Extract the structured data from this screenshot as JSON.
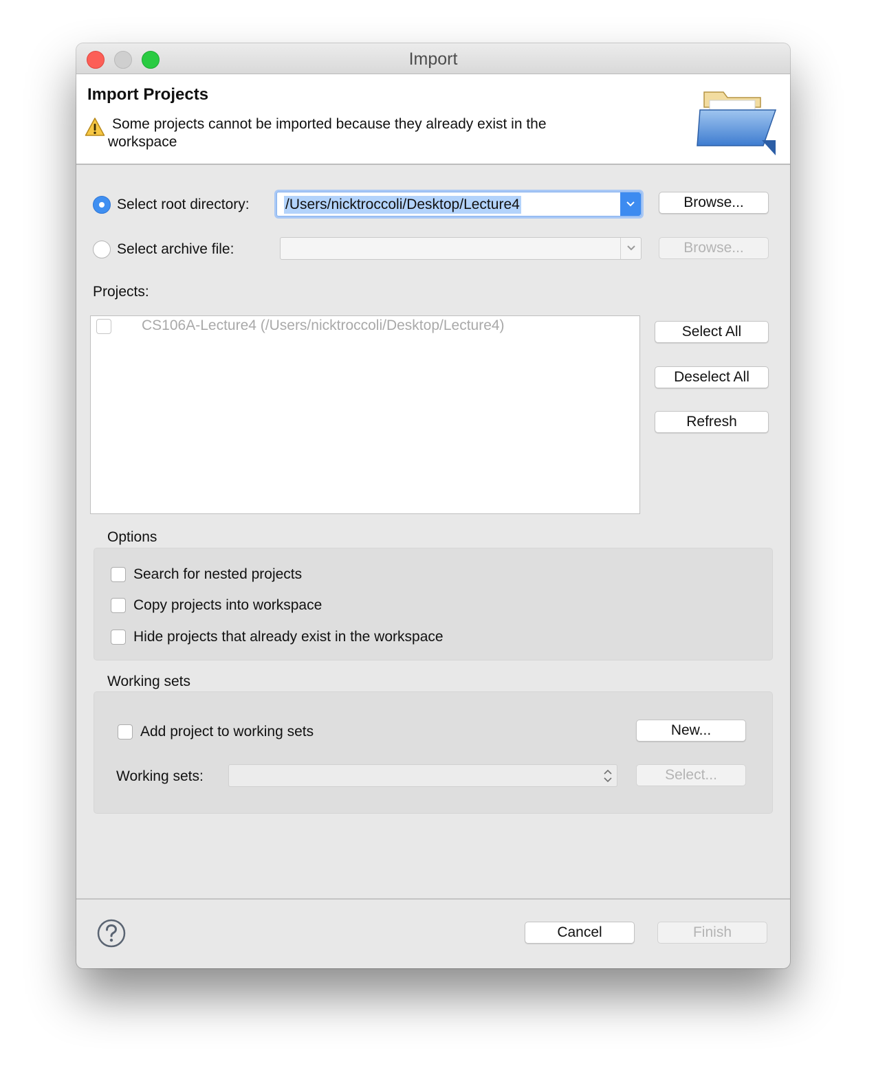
{
  "window": {
    "title": "Import"
  },
  "banner": {
    "title": "Import Projects",
    "message_line1": "Some projects cannot be imported because they already exist in the",
    "message_line2": "workspace"
  },
  "source": {
    "root_label": "Select root directory:",
    "root_value": "/Users/nicktroccoli/Desktop/Lecture4",
    "root_selected": true,
    "archive_label": "Select archive file:",
    "archive_value": "",
    "archive_selected": false,
    "browse_label": "Browse..."
  },
  "projects": {
    "label": "Projects:",
    "items": [
      {
        "label": "CS106A-Lecture4 (/Users/nicktroccoli/Desktop/Lecture4)",
        "checked": false,
        "enabled": false
      }
    ],
    "select_all": "Select All",
    "deselect_all": "Deselect All",
    "refresh": "Refresh"
  },
  "options": {
    "title": "Options",
    "items": [
      {
        "label": "Search for nested projects",
        "checked": false
      },
      {
        "label": "Copy projects into workspace",
        "checked": false
      },
      {
        "label": "Hide projects that already exist in the workspace",
        "checked": false
      }
    ]
  },
  "working_sets": {
    "title": "Working sets",
    "add_label": "Add project to working sets",
    "add_checked": false,
    "new_button": "New...",
    "sets_label": "Working sets:",
    "sets_value": "",
    "select_button": "Select..."
  },
  "footer": {
    "cancel": "Cancel",
    "finish": "Finish"
  },
  "icons": {
    "warning": "warning-icon",
    "folder": "folder-icon",
    "help": "help-icon"
  },
  "colors": {
    "accent": "#3f8ff1",
    "selection": "#b3d3fb",
    "close": "#fc5f57",
    "minimize": "#cfcfcf",
    "maximize": "#2acb42"
  }
}
